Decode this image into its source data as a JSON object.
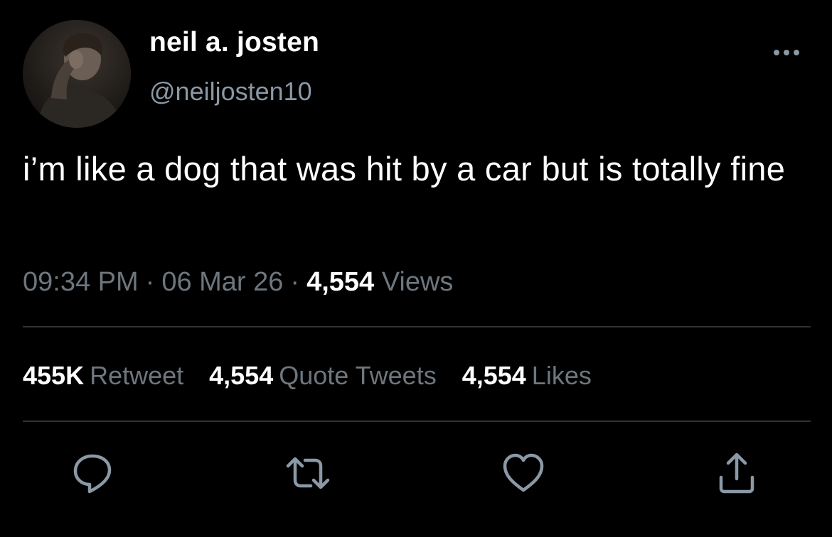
{
  "author": {
    "display_name": "neil a. josten",
    "handle": "@neiljosten10"
  },
  "tweet": {
    "text": "i’m like a dog that was hit by a car but is totally fine",
    "time": "09:34 PM",
    "date": "06 Mar 26",
    "views_count": "4,554",
    "views_label": "Views"
  },
  "stats": {
    "retweets_count": "455K",
    "retweets_label": "Retweet",
    "quotes_count": "4,554",
    "quotes_label": "Quote Tweets",
    "likes_count": "4,554",
    "likes_label": "Likes"
  },
  "icons": {
    "more": "more-horizontal-icon",
    "reply": "reply-icon",
    "retweet": "retweet-icon",
    "like": "heart-icon",
    "share": "share-icon"
  },
  "colors": {
    "background": "#000000",
    "primary_text": "#ffffff",
    "secondary_text": "#6e767d",
    "divider": "#2f3336",
    "icon": "#8b98a5"
  }
}
